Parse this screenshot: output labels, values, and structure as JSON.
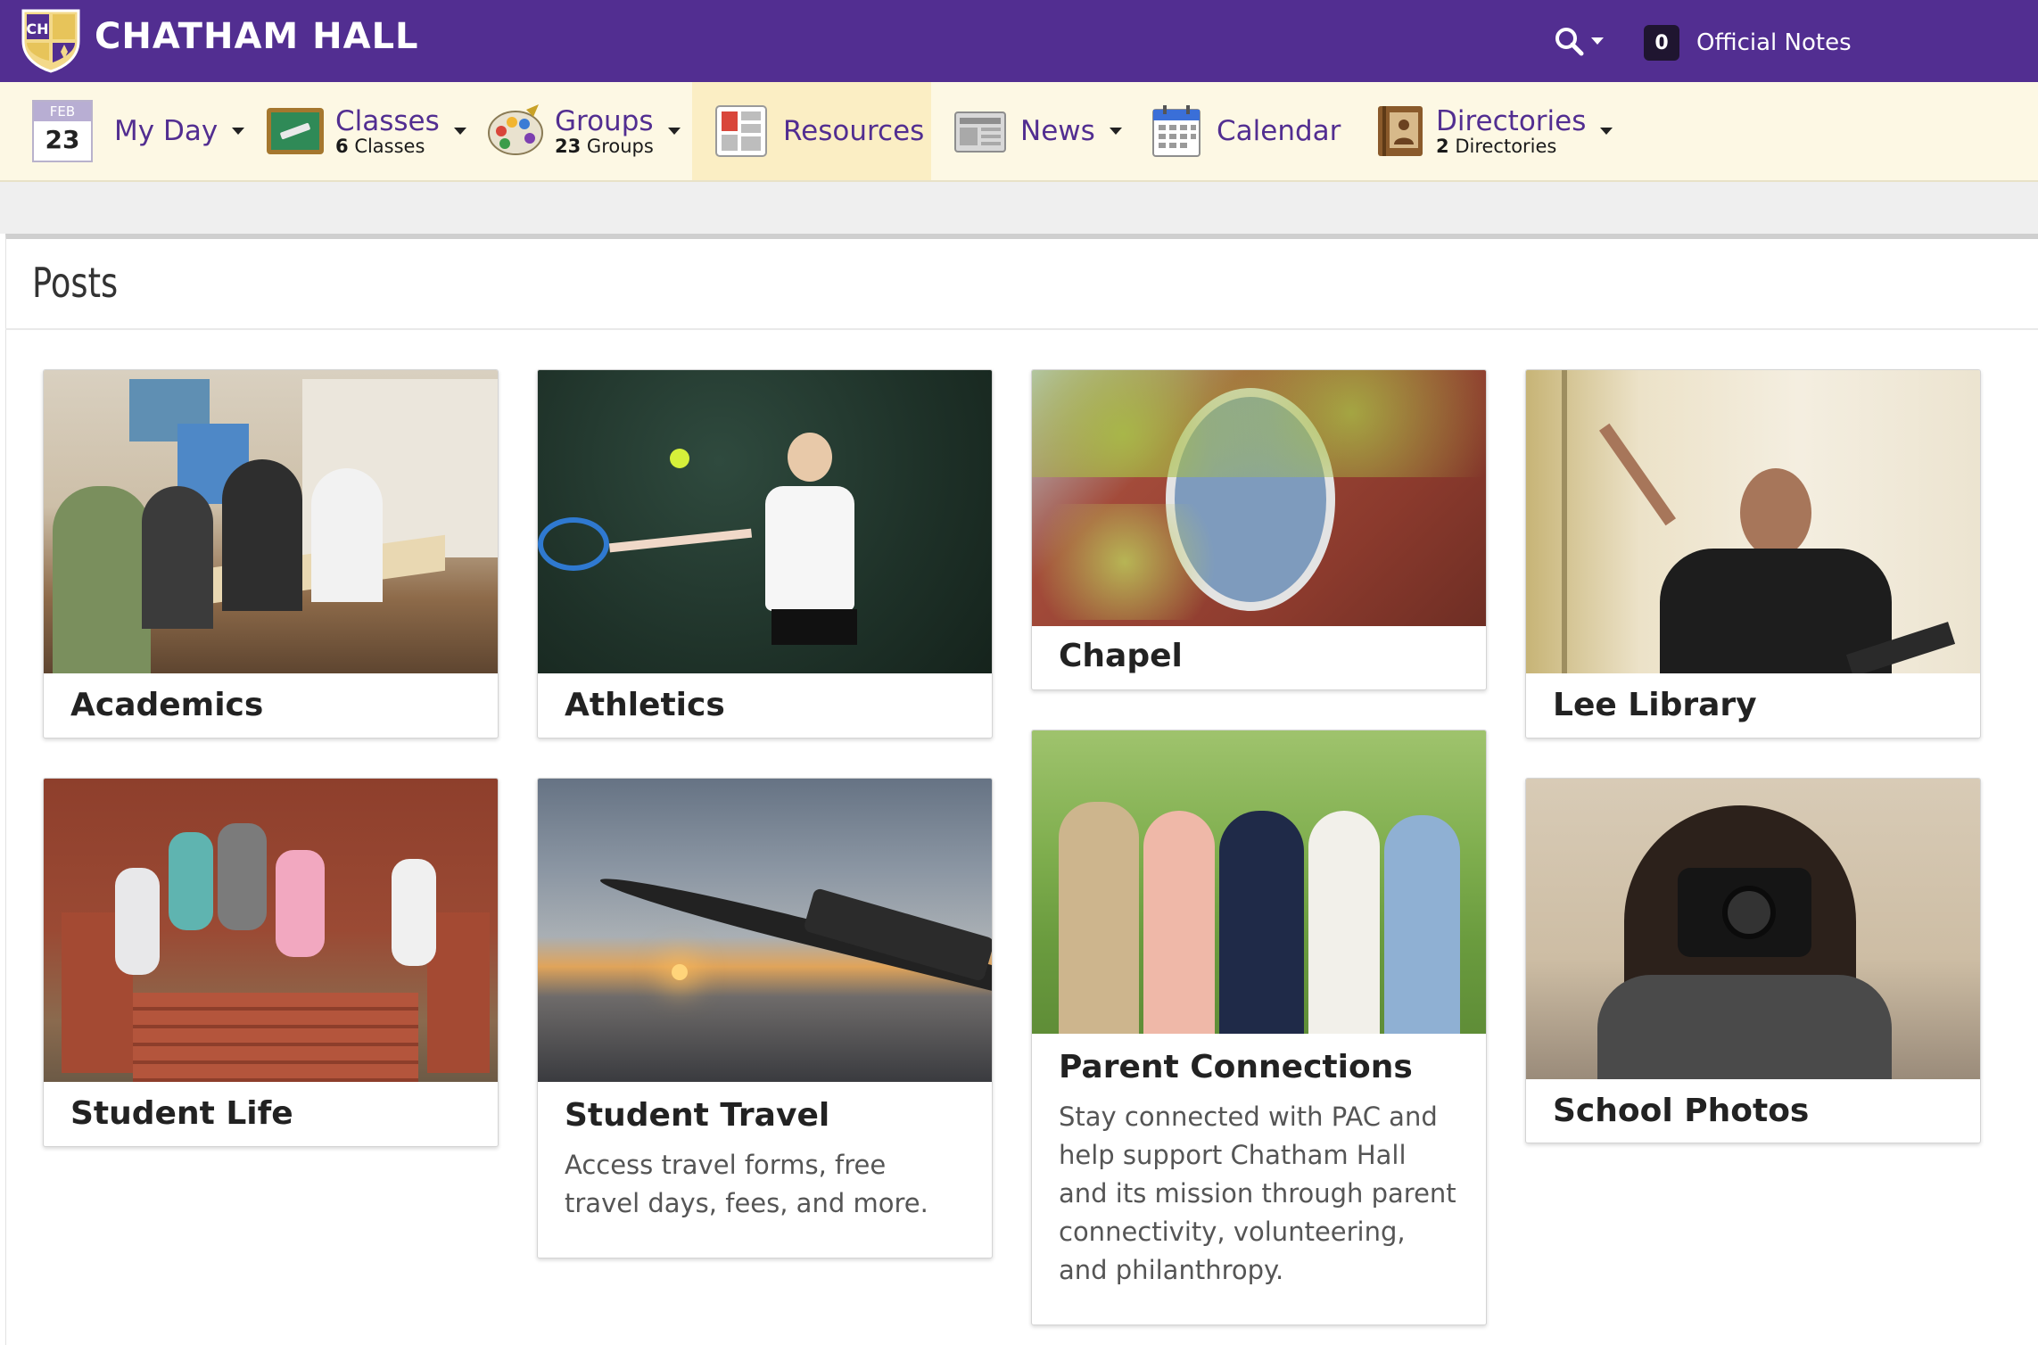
{
  "header": {
    "brand": "CHATHAM HALL",
    "logo_text": "CH",
    "notes_count": "0",
    "notes_label": "Official Notes"
  },
  "nav": {
    "myday": {
      "month": "FEB",
      "day": "23",
      "label": "My Day"
    },
    "classes": {
      "label": "Classes",
      "count": "6",
      "sub": "Classes"
    },
    "groups": {
      "label": "Groups",
      "count": "23",
      "sub": "Groups"
    },
    "resources": {
      "label": "Resources"
    },
    "news": {
      "label": "News"
    },
    "calendar": {
      "label": "Calendar"
    },
    "directories": {
      "label": "Directories",
      "count": "2",
      "sub": "Directories"
    }
  },
  "main": {
    "title": "Posts",
    "cards": [
      {
        "title": "Academics",
        "desc": ""
      },
      {
        "title": "Athletics",
        "desc": ""
      },
      {
        "title": "Chapel",
        "desc": ""
      },
      {
        "title": "Lee Library",
        "desc": ""
      },
      {
        "title": "Student Life",
        "desc": ""
      },
      {
        "title": "Student Travel",
        "desc": "Access travel forms, free travel days, fees, and more."
      },
      {
        "title": "Parent Connections",
        "desc": "Stay connected with PAC and help support Chatham Hall and its mission through parent connectivity, volunteering, and philanthropy."
      },
      {
        "title": "School Photos",
        "desc": ""
      }
    ]
  },
  "colors": {
    "brand_purple": "#522e91",
    "nav_bg": "#fdf8e4",
    "active_nav_bg": "#fbeec4"
  }
}
